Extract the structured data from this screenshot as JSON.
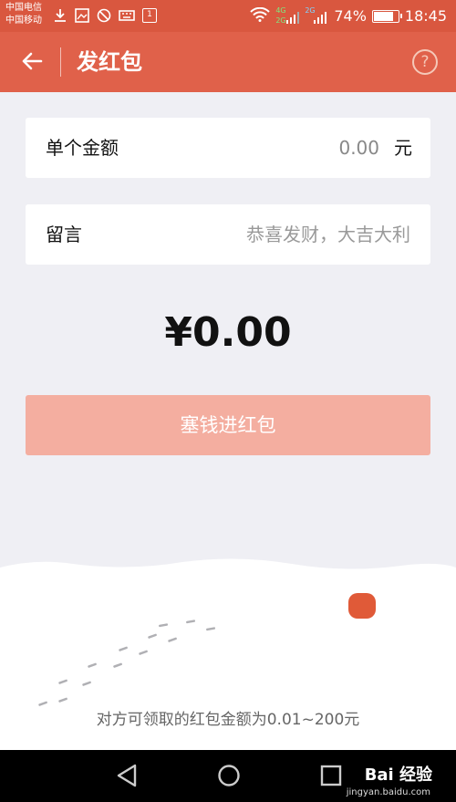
{
  "status_bar": {
    "carrier_1": "中国电信",
    "carrier_2": "中国移动",
    "icons": [
      "download-icon",
      "image-icon",
      "blocked-icon",
      "keyboard-icon",
      "notification-1-icon"
    ],
    "notification_count": "1",
    "network_1": "4G",
    "network_2": "2G",
    "network_3": "2G",
    "battery": "74%",
    "time": "18:45"
  },
  "header": {
    "title": "发红包",
    "back_icon": "arrow-left-icon",
    "help_icon": "question-circle-icon",
    "help_glyph": "?"
  },
  "form": {
    "amount_label": "单个金额",
    "amount_value": "0.00",
    "amount_unit": "元",
    "message_label": "留言",
    "message_placeholder": "恭喜发财，大吉大利"
  },
  "total": "¥0.00",
  "submit_button": "塞钱进红包",
  "footer_note": "对方可领取的红包金额为0.01~200元",
  "nav": {
    "watermark": "Bai 经验",
    "watermark_sub": "jingyan.baidu.com"
  },
  "colors": {
    "title_bar": "#e0614a",
    "status_bar": "#d9573f",
    "button_disabled": "#f4aea0",
    "background": "#efeff4"
  }
}
